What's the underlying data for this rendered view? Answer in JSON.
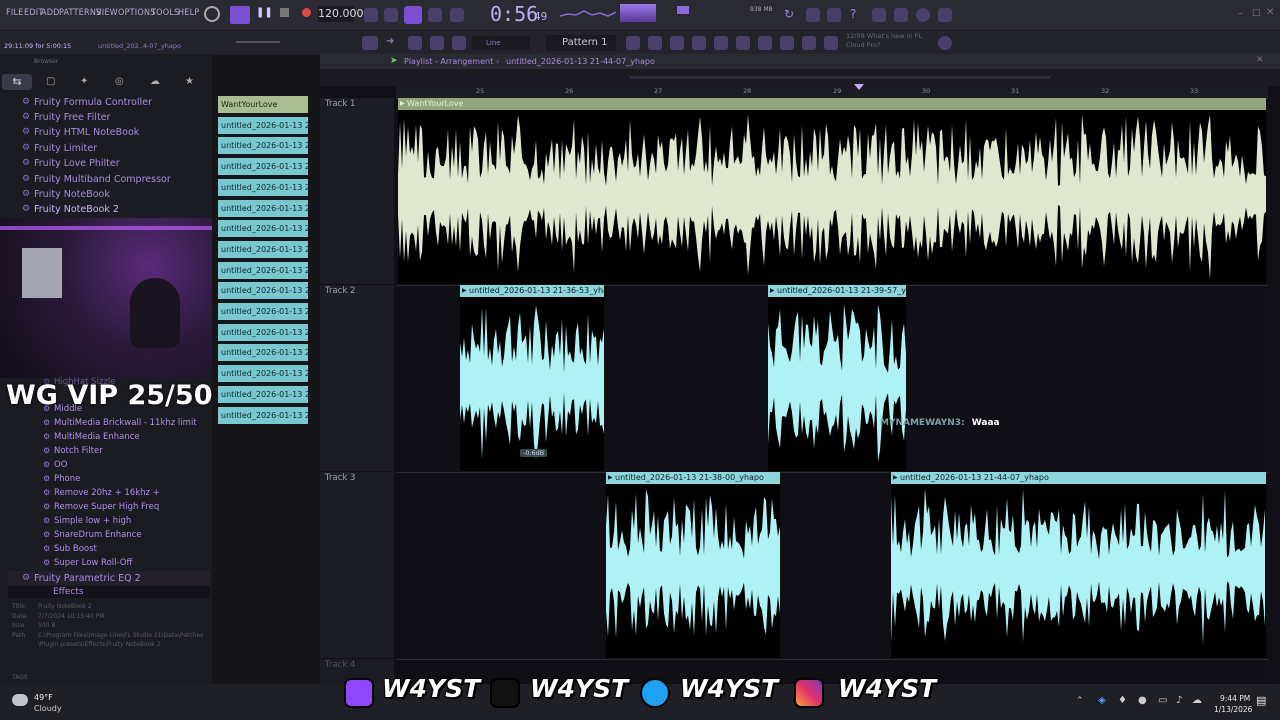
{
  "menu": [
    "FILE",
    "EDIT",
    "ADD",
    "PATTERNS",
    "VIEW",
    "OPTIONS",
    "TOOLS",
    "HELP"
  ],
  "tempo": "120.000",
  "time": "0:56",
  "time_frac": "49",
  "hint_time": "29:11:09 for 5:00:15",
  "hint_file": "untitled_202..4-07_yhapo",
  "pattern": "Pattern 1",
  "snap": "Line",
  "cpu": "938 MB",
  "news": "12/09 What's new in FL Cloud Pro?",
  "browser_title": "Browser",
  "playlist_title": "Playlist - Arrangement",
  "playlist_file": "untitled_2026-01-13 21-44-07_yhapo",
  "plugins": [
    "Fruity Formula Controller",
    "Fruity Free Filter",
    "Fruity HTML NoteBook",
    "Fruity Limiter",
    "Fruity Love Philter",
    "Fruity Multiband Compressor",
    "Fruity NoteBook",
    "Fruity NoteBook 2"
  ],
  "presets": [
    "HighHat Sizzle",
    "Middle",
    "MultiMedia Brickwall - 11khz limit",
    "MultiMedia Enhance",
    "Notch Filter",
    "OO",
    "Phone",
    "Remove 20hz + 16khz +",
    "Remove Super High Freq",
    "Simple low + high",
    "SnareDrum Enhance",
    "Sub Boost",
    "Super Low Roll-Off"
  ],
  "plugin_bottom": "Fruity Parametric EQ 2",
  "effects_folder": "Effects",
  "info": {
    "title_label": "Title",
    "title": "Fruity NoteBook 2",
    "date_label": "Date",
    "date": "7/7/2024 10:15:40 PM",
    "size_label": "Size",
    "size": "500 B",
    "path_label": "Path",
    "path": "C:\\Program Files\\Image-Line\\FL Studio 21\\Data\\Patches\\Plugin presets\\Effects\\Fruity NoteBook 2"
  },
  "tags_label": "TAGS",
  "vip_text": "WG VIP 25/50",
  "picker_clips": [
    "WantYourLove",
    "untitled_2026-01-13 21-",
    "untitled_2026-01-13 21-",
    "untitled_2026-01-13 21-",
    "untitled_2026-01-13 21-",
    "untitled_2026-01-13 21-",
    "untitled_2026-01-13 21-",
    "untitled_2026-01-13 21-",
    "untitled_2026-01-13 21-",
    "untitled_2026-01-13 21-",
    "untitled_2026-01-13 21-",
    "untitled_2026-01-13 21-",
    "untitled_2026-01-13 21-",
    "untitled_2026-01-13 21-",
    "untitled_2026-01-13 21-",
    "untitled_2026-01-13 21-"
  ],
  "ruler": [
    "25",
    "26",
    "27",
    "28",
    "29",
    "30",
    "31",
    "32",
    "33"
  ],
  "tracks": [
    "Track 1",
    "Track 2",
    "Track 3",
    "Track 4"
  ],
  "clips": {
    "t1": "WantYourLove",
    "t2a": "untitled_2026-01-13 21-36-53_yhapo",
    "t2b": "untitled_2026-01-13 21-39-57_yhapo",
    "t3a": "untitled_2026-01-13 21-38-00_yhapo",
    "t3b": "untitled_2026-01-13 21-44-07_yhapo"
  },
  "gain_label": "-0.6dB",
  "chat": {
    "user": "MYNAMEWAYN3:",
    "message": "Waaa"
  },
  "socials": [
    "W4YST",
    "W4YST",
    "W4YST",
    "W4YST"
  ],
  "weather": {
    "temp": "49°F",
    "desc": "Cloudy"
  },
  "clock": {
    "time": "9:44 PM",
    "date": "1/13/2026"
  },
  "colors": {
    "accent": "#7b4fd1",
    "clip_teal": "#8ed6dc",
    "wave_pale": "#dfe8cf",
    "wave_teal": "#aef2f6"
  }
}
